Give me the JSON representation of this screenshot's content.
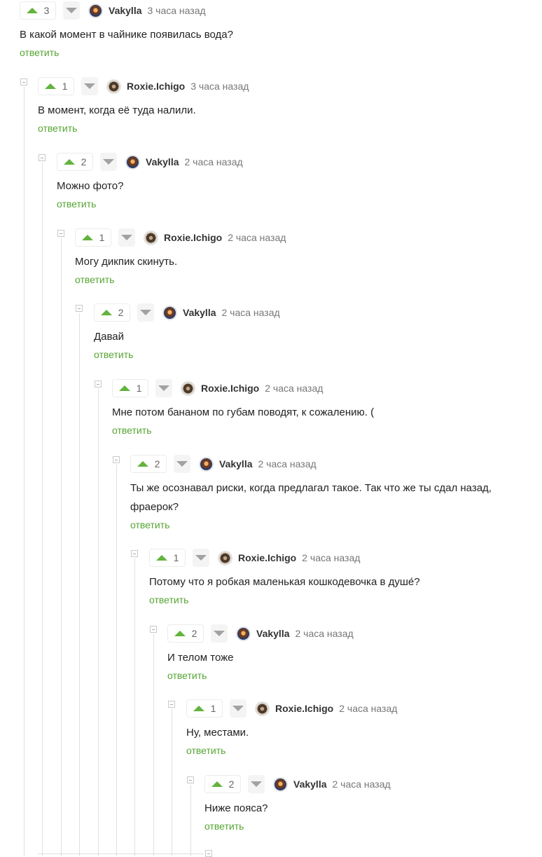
{
  "labels": {
    "reply": "ответить"
  },
  "colors": {
    "upvote": "#63b33d",
    "downvote": "#a2a2a2",
    "reply_link": "#56a533"
  },
  "icons": {
    "upvote": "triangle-up-icon",
    "downvote": "triangle-down-icon",
    "collapse": "minus-square-icon"
  },
  "comments": [
    {
      "score": "3",
      "author": "Vakylla",
      "time": "3 часа назад",
      "text": "В какой момент в чайнике появилась вода?"
    },
    {
      "score": "1",
      "author": "Roxie.Ichigo",
      "time": "3 часа назад",
      "text": "В момент, когда её туда налили."
    },
    {
      "score": "2",
      "author": "Vakylla",
      "time": "2 часа назад",
      "text": "Можно фото?"
    },
    {
      "score": "1",
      "author": "Roxie.Ichigo",
      "time": "2 часа назад",
      "text": "Могу дикпик скинуть."
    },
    {
      "score": "2",
      "author": "Vakylla",
      "time": "2 часа назад",
      "text": "Давай"
    },
    {
      "score": "1",
      "author": "Roxie.Ichigo",
      "time": "2 часа назад",
      "text": "Мне потом бананом по губам поводят, к сожалению. ("
    },
    {
      "score": "2",
      "author": "Vakylla",
      "time": "2 часа назад",
      "text": "Ты же осознавал риски, когда предлагал такое. Так что же ты сдал назад, фраерок?"
    },
    {
      "score": "1",
      "author": "Roxie.Ichigo",
      "time": "2 часа назад",
      "text": "Потому что я робкая маленькая кошкодевочка в душе́?"
    },
    {
      "score": "2",
      "author": "Vakylla",
      "time": "2 часа назад",
      "text": "И телом тоже"
    },
    {
      "score": "1",
      "author": "Roxie.Ichigo",
      "time": "2 часа назад",
      "text": "Ну, местами."
    },
    {
      "score": "2",
      "author": "Vakylla",
      "time": "2 часа назад",
      "text": "Ниже пояса?"
    }
  ]
}
